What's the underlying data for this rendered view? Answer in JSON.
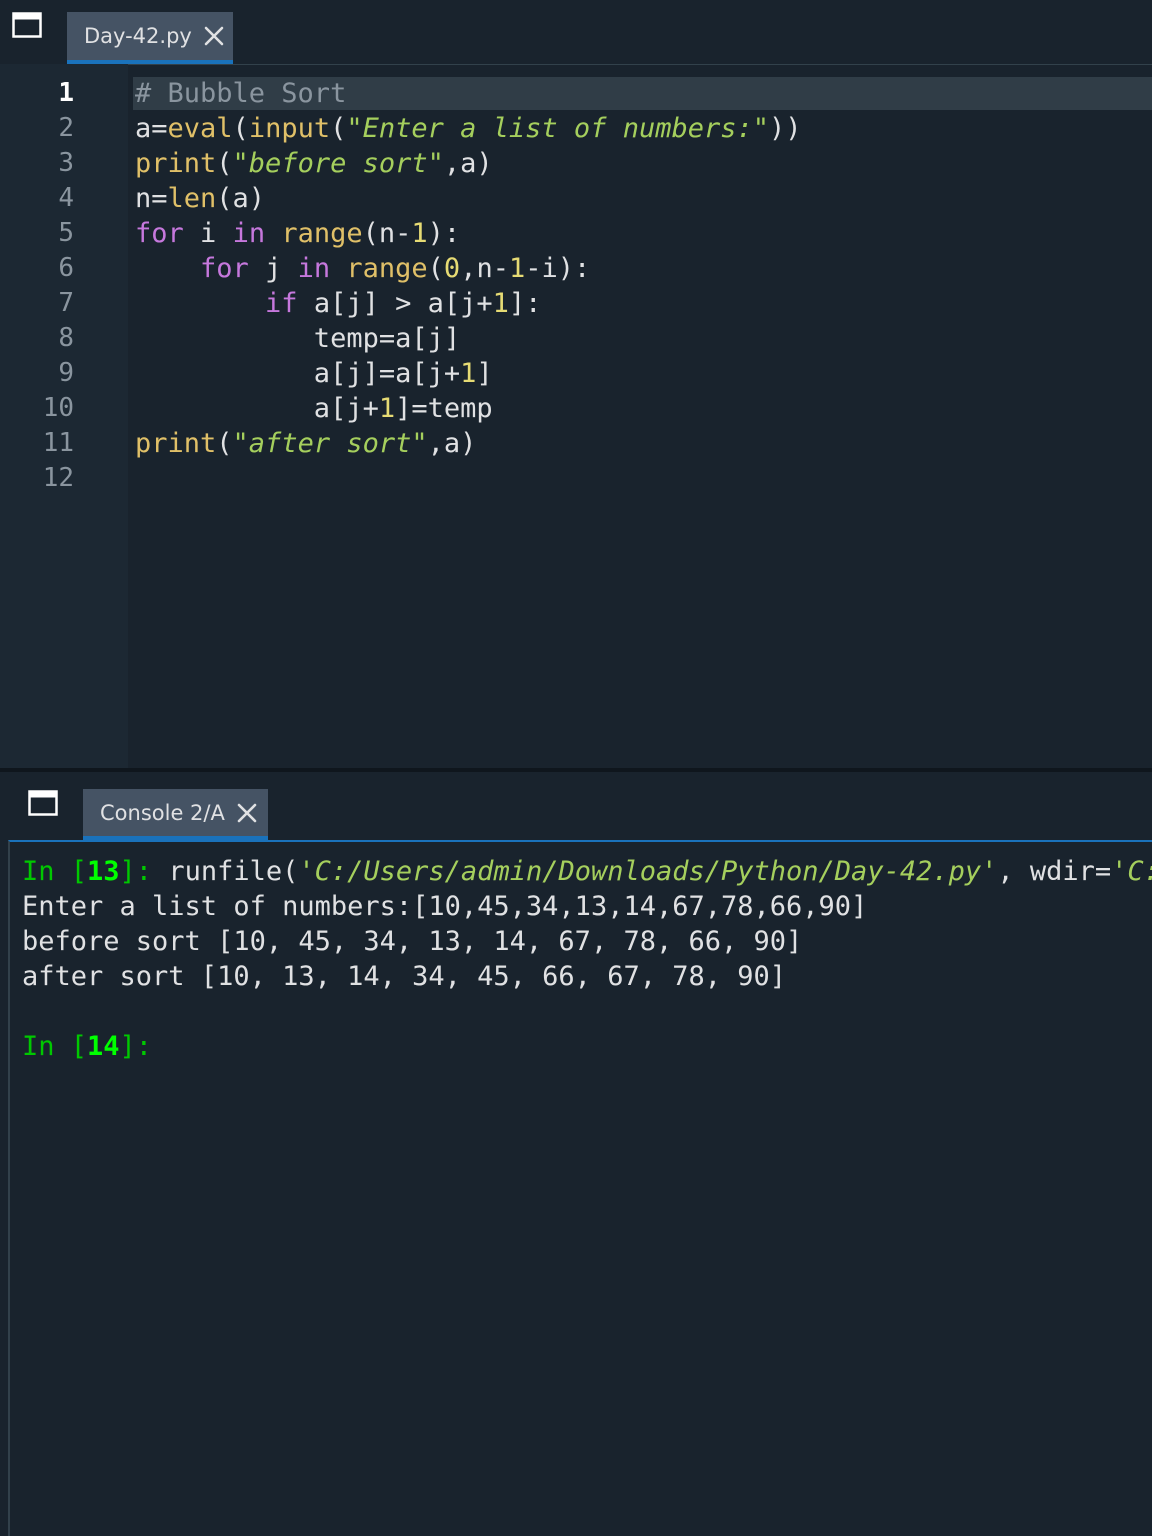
{
  "editor": {
    "tab": {
      "label": "Day-42.py"
    },
    "current_line": "1",
    "line_numbers": [
      "1",
      "2",
      "3",
      "4",
      "5",
      "6",
      "7",
      "8",
      "9",
      "10",
      "11",
      "12"
    ],
    "lines": [
      [
        {
          "t": "comment",
          "v": "# Bubble Sort"
        }
      ],
      [
        {
          "t": "plain",
          "v": "a="
        },
        {
          "t": "builtin",
          "v": "eval"
        },
        {
          "t": "plain",
          "v": "("
        },
        {
          "t": "builtin",
          "v": "input"
        },
        {
          "t": "plain",
          "v": "("
        },
        {
          "t": "string",
          "v": "\"Enter a list of numbers:\""
        },
        {
          "t": "plain",
          "v": "))"
        }
      ],
      [
        {
          "t": "builtin",
          "v": "print"
        },
        {
          "t": "plain",
          "v": "("
        },
        {
          "t": "string",
          "v": "\"before sort\""
        },
        {
          "t": "plain",
          "v": ",a)"
        }
      ],
      [
        {
          "t": "plain",
          "v": "n="
        },
        {
          "t": "builtin",
          "v": "len"
        },
        {
          "t": "plain",
          "v": "(a)"
        }
      ],
      [
        {
          "t": "keyword",
          "v": "for"
        },
        {
          "t": "plain",
          "v": " i "
        },
        {
          "t": "keyword",
          "v": "in"
        },
        {
          "t": "plain",
          "v": " "
        },
        {
          "t": "builtin",
          "v": "range"
        },
        {
          "t": "plain",
          "v": "(n-"
        },
        {
          "t": "number",
          "v": "1"
        },
        {
          "t": "plain",
          "v": "):"
        }
      ],
      [
        {
          "t": "plain",
          "v": "    "
        },
        {
          "t": "keyword",
          "v": "for"
        },
        {
          "t": "plain",
          "v": " j "
        },
        {
          "t": "keyword",
          "v": "in"
        },
        {
          "t": "plain",
          "v": " "
        },
        {
          "t": "builtin",
          "v": "range"
        },
        {
          "t": "plain",
          "v": "("
        },
        {
          "t": "number",
          "v": "0"
        },
        {
          "t": "plain",
          "v": ",n-"
        },
        {
          "t": "number",
          "v": "1"
        },
        {
          "t": "plain",
          "v": "-i):"
        }
      ],
      [
        {
          "t": "plain",
          "v": "        "
        },
        {
          "t": "keyword",
          "v": "if"
        },
        {
          "t": "plain",
          "v": " a[j] > a[j+"
        },
        {
          "t": "number",
          "v": "1"
        },
        {
          "t": "plain",
          "v": "]:"
        }
      ],
      [
        {
          "t": "plain",
          "v": "           temp=a[j]"
        }
      ],
      [
        {
          "t": "plain",
          "v": "           a[j]=a[j+"
        },
        {
          "t": "number",
          "v": "1"
        },
        {
          "t": "plain",
          "v": "]"
        }
      ],
      [
        {
          "t": "plain",
          "v": "           a[j+"
        },
        {
          "t": "number",
          "v": "1"
        },
        {
          "t": "plain",
          "v": "]=temp"
        }
      ],
      [
        {
          "t": "builtin",
          "v": "print"
        },
        {
          "t": "plain",
          "v": "("
        },
        {
          "t": "string",
          "v": "\"after sort\""
        },
        {
          "t": "plain",
          "v": ",a)"
        }
      ],
      []
    ]
  },
  "console": {
    "tab": {
      "label": "Console 2/A"
    },
    "entries": [
      {
        "prompt": "In [",
        "num": "13",
        "end": "]:",
        "code_prefix": " runfile(",
        "code_path": "'C:/Users/admin/Downloads/Python/Day-42.py'",
        "code_sep": ", wdir=",
        "code_wdir": "'C:/Us"
      },
      {
        "output": "Enter a list of numbers:[10,45,34,13,14,67,78,66,90]"
      },
      {
        "output": "before sort [10, 45, 34, 13, 14, 67, 78, 66, 90]"
      },
      {
        "output": "after sort [10, 13, 14, 34, 45, 66, 67, 78, 90]"
      },
      {
        "blank": true
      },
      {
        "prompt": "In [",
        "num": "14",
        "end": "]:"
      }
    ]
  }
}
